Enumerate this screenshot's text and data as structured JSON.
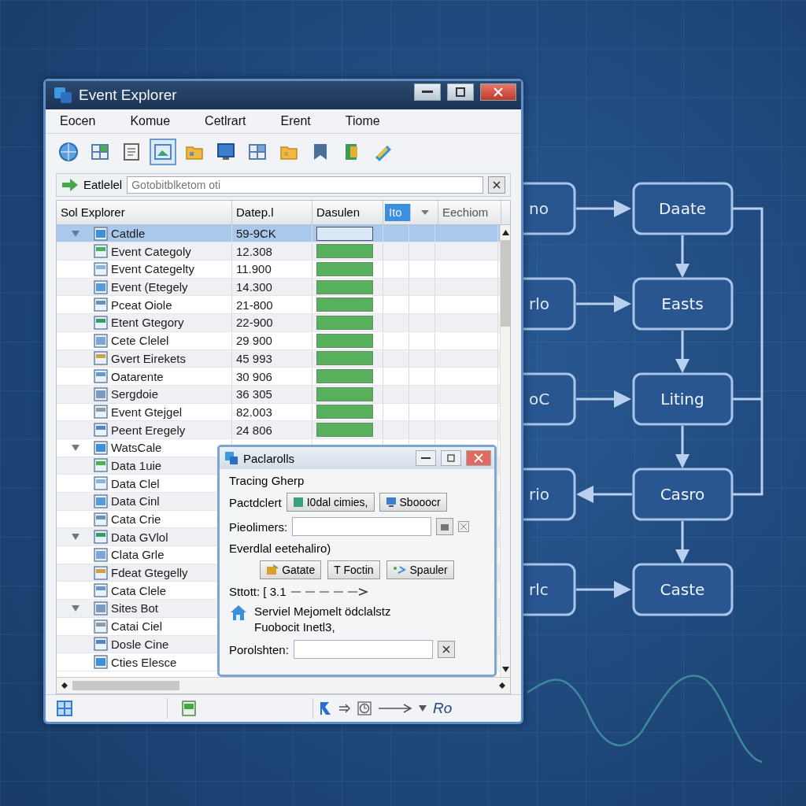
{
  "window": {
    "title": "Event Explorer"
  },
  "menu": [
    "Eocen",
    "Komue",
    "Cetlrart",
    "Erent",
    "Tiome"
  ],
  "filter": {
    "label": "Eatlelel",
    "placeholder": "Gotobitblketom oti"
  },
  "table": {
    "columns": [
      {
        "label": "Sol Explorer",
        "selected": false
      },
      {
        "label": "Datep.l",
        "selected": false
      },
      {
        "label": "Dasulen",
        "selected": false
      },
      {
        "label": "Ito",
        "selected": true
      },
      {
        "label": "Eechiom",
        "selected": false
      }
    ],
    "rows": [
      {
        "name": "Catdle",
        "expanded": true,
        "selected": true,
        "value": "59-9CK",
        "level": 0,
        "children": [
          {
            "name": "Event Categoly",
            "selected": false,
            "value": "12.308",
            "level": 1
          },
          {
            "name": "Event Categelty",
            "selected": false,
            "value": "11.900",
            "level": 1
          },
          {
            "name": "Event (Etegely",
            "selected": false,
            "value": "14.300",
            "level": 1
          },
          {
            "name": "Pceat Oiole",
            "selected": false,
            "value": "21-800",
            "level": 1
          },
          {
            "name": "Etent Gtegory",
            "selected": false,
            "value": "22-900",
            "level": 1
          },
          {
            "name": "Cete Clelel",
            "selected": false,
            "value": "29 900",
            "level": 1
          },
          {
            "name": "Gvert Eirekets",
            "selected": false,
            "value": "45 993",
            "level": 1
          },
          {
            "name": "Oatarente",
            "selected": false,
            "value": "30 906",
            "level": 1
          },
          {
            "name": "Sergdoie",
            "selected": false,
            "value": "36 305",
            "level": 1
          },
          {
            "name": "Event Gtejgel",
            "selected": false,
            "value": "82.003",
            "level": 1
          },
          {
            "name": "Peent Eregely",
            "selected": false,
            "value": "24 806",
            "level": 1
          }
        ]
      },
      {
        "name": "WatsCale",
        "expanded": true,
        "selected": false,
        "children": [
          {
            "name": "Data 1uie",
            "selected": false
          },
          {
            "name": "Data Clel",
            "selected": false
          },
          {
            "name": "Data Cinl",
            "selected": false
          },
          {
            "name": "Cata Crie",
            "selected": false
          }
        ]
      },
      {
        "name": "Data GVlol",
        "expanded": true,
        "selected": false,
        "children": [
          {
            "name": "Clata Grle",
            "selected": false
          },
          {
            "name": "Fdeat Gtegelly",
            "selected": false
          },
          {
            "name": "Cata Clele",
            "selected": false
          }
        ]
      },
      {
        "name": "Sites Bot",
        "expanded": true,
        "selected": false,
        "children": [
          {
            "name": "Catai Ciel",
            "selected": false
          },
          {
            "name": "Dosle Cine",
            "selected": false
          },
          {
            "name": "Cties Elesce",
            "selected": false
          }
        ]
      }
    ]
  },
  "status_bar": {
    "text": "Ro"
  },
  "dialog": {
    "title": "Paclarolls",
    "heading": "Tracing Gherp",
    "row_label": "Pactdclert",
    "row_buttons": [
      "I0dal cimies,",
      "Sbooocr"
    ],
    "field1_label": "Pieolimers:",
    "section": "Everdlal eetehaliro)",
    "buttons": [
      "Gatate",
      "T Foctin",
      "Spauler"
    ],
    "scale_label": "Sttott: [ 3.1",
    "note": [
      "Serviel Mejomelt ödclalstz",
      "Fuobocit Inetl3,"
    ],
    "field2_label": "Porolshten:"
  },
  "flowchart": {
    "rows": [
      {
        "left": "no",
        "right": "Daate",
        "points_left": false
      },
      {
        "left": "rlo",
        "right": "Easts",
        "points_left": false
      },
      {
        "left": "oC",
        "right": "Liting",
        "points_left": false
      },
      {
        "left": "rio",
        "right": "Casro",
        "points_left": true
      },
      {
        "left": "rlc",
        "right": "Caste",
        "points_left": false
      }
    ]
  }
}
